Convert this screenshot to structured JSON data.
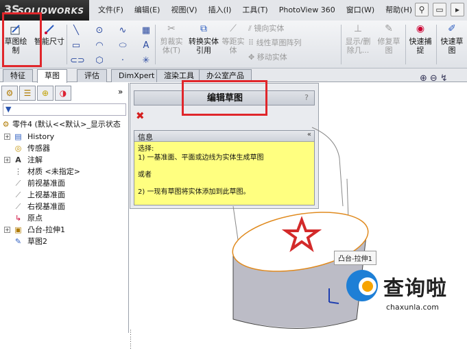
{
  "app": {
    "ds_mark": "3S",
    "brand": "SOLIDWORKS"
  },
  "menu": [
    "文件(F)",
    "编辑(E)",
    "视图(V)",
    "插入(I)",
    "工具(T)",
    "PhotoView 360",
    "窗口(W)",
    "帮助(H)"
  ],
  "toolbar": {
    "sketch_btn": "草图绘制",
    "smart_dim": "智能尺寸",
    "trim": "剪裁实体(T)",
    "convert": "转换实体引用",
    "offset": "等距实体",
    "mirror": "镜向实体",
    "linear_pattern": "线性草图阵列",
    "move": "移动实体",
    "display_delete": "显示/删除几...",
    "repair": "修复草图",
    "quick_snap": "快速捕捉",
    "quick_sketch": "快速草图"
  },
  "tabs": [
    "特征",
    "草图",
    "评估",
    "DimXpert",
    "渲染工具",
    "办公室产品"
  ],
  "active_tab_index": 1,
  "tree": {
    "root": "零件4 (默认<<默认>_显示状态",
    "items": [
      "History",
      "传感器",
      "注解",
      "材质 <未指定>",
      "前视基准面",
      "上视基准面",
      "右视基准面",
      "原点",
      "凸台-拉伸1",
      "草图2"
    ]
  },
  "property_manager": {
    "title": "编辑草图",
    "help": "?",
    "info_title": "信息",
    "info_collapse": "«",
    "info_lines": [
      "选择:",
      "1) 一基准面、平面或边线为实体生成草图",
      "或者",
      "2) 一现有草图将实体添加到此草图。"
    ]
  },
  "graphics": {
    "feature_label": "凸台-拉伸1"
  },
  "watermark": {
    "text": "查询啦",
    "url": "chaxunla.com"
  },
  "colors": {
    "highlight_box": "#e0262b",
    "info_bg": "#ffff80",
    "star": "#d32a2a",
    "edge": "#e08a1e",
    "cylinder": "#bcbcc6"
  }
}
